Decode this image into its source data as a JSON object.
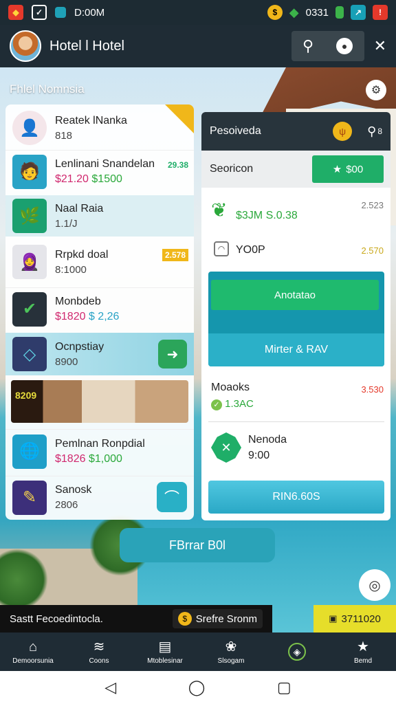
{
  "status_bar": {
    "time": "D:00M",
    "right_text": "0331"
  },
  "header": {
    "title": "Hotel l Hotel",
    "subtitle": "Fhlel Nomnsia"
  },
  "list": {
    "items": [
      {
        "name": "Reatek lNanka",
        "sub": "818"
      },
      {
        "name": "Lenlinani Snandelan",
        "price_a": "$21.20",
        "price_b": "$1500",
        "badge": "29.38"
      },
      {
        "name": "Naal Raia",
        "sub": "1.1/J"
      },
      {
        "name": "Rrpkd doal",
        "sub": "8:1000",
        "badge": "2.578"
      },
      {
        "name": "Monbdeb",
        "price_a": "$1820",
        "price_b": "$ 2,26"
      },
      {
        "name": "Ocnpstiay",
        "sub": "8900"
      },
      {
        "name": "",
        "image_caption": "8209"
      },
      {
        "name": "Pemlnan Ronpdial",
        "price_a": "$1826",
        "price_b": "$1,000"
      },
      {
        "name": "Sanosk",
        "sub": "2806"
      }
    ]
  },
  "panel": {
    "title": "Pesoiveda",
    "header_count": "8",
    "section_label": "Seoricon",
    "price_button": "$00",
    "row1": {
      "value": "$3JM S.0.38",
      "num": "2.523"
    },
    "row2": {
      "label": "YO0P",
      "num": "2.570"
    },
    "action_primary": "Anotatao",
    "action_secondary": "Mirter & RAV",
    "row3": {
      "label": "Moaoks",
      "value": "1.3AC",
      "num": "3.530"
    },
    "row4": {
      "label": "Nenoda",
      "value": "9:00"
    },
    "bottom_button": "RIN6.60S"
  },
  "fab_button": "FBrrar B0l",
  "ticker": {
    "left": "Sastt Fecoedintocla.",
    "mid": "Srefre Sronm",
    "right": "3711020"
  },
  "navbar": [
    {
      "label": "Demoorsunia",
      "icon": "home-icon"
    },
    {
      "label": "Coons",
      "icon": "wifi-icon"
    },
    {
      "label": "Mtoblesinar",
      "icon": "book-icon"
    },
    {
      "label": "Slsogam",
      "icon": "paw-icon"
    },
    {
      "label": "",
      "icon": "compass-icon"
    },
    {
      "label": "Bemd",
      "icon": "star-icon"
    }
  ]
}
